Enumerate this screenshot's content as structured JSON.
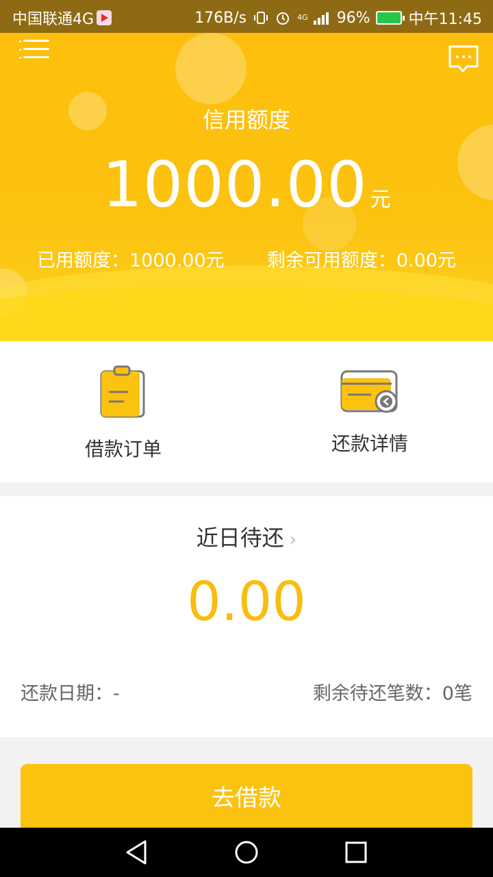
{
  "status_bar": {
    "carrier": "中国联通4G",
    "speed": "176B/s",
    "network": "4G",
    "battery": "96%",
    "time": "中午11:45"
  },
  "header": {
    "credit_label": "信用额度",
    "credit_amount": "1000.00",
    "credit_unit": "元",
    "used_text": "已用额度：1000.00元",
    "remaining_text": "剩余可用额度：0.00元"
  },
  "actions": [
    {
      "label": "借款订单",
      "icon": "clipboard-icon"
    },
    {
      "label": "还款详情",
      "icon": "card-return-icon"
    }
  ],
  "recent": {
    "title": "近日待还",
    "chevron": "›",
    "amount": "0.00",
    "repay_date": "还款日期：-",
    "remaining_count": "剩余待还笔数：0笔"
  },
  "borrow_button": {
    "label": "去借款"
  },
  "colors": {
    "accent": "#fcc210",
    "status_bar": "#8e6a14",
    "amount_accent": "#f9bd0f"
  }
}
